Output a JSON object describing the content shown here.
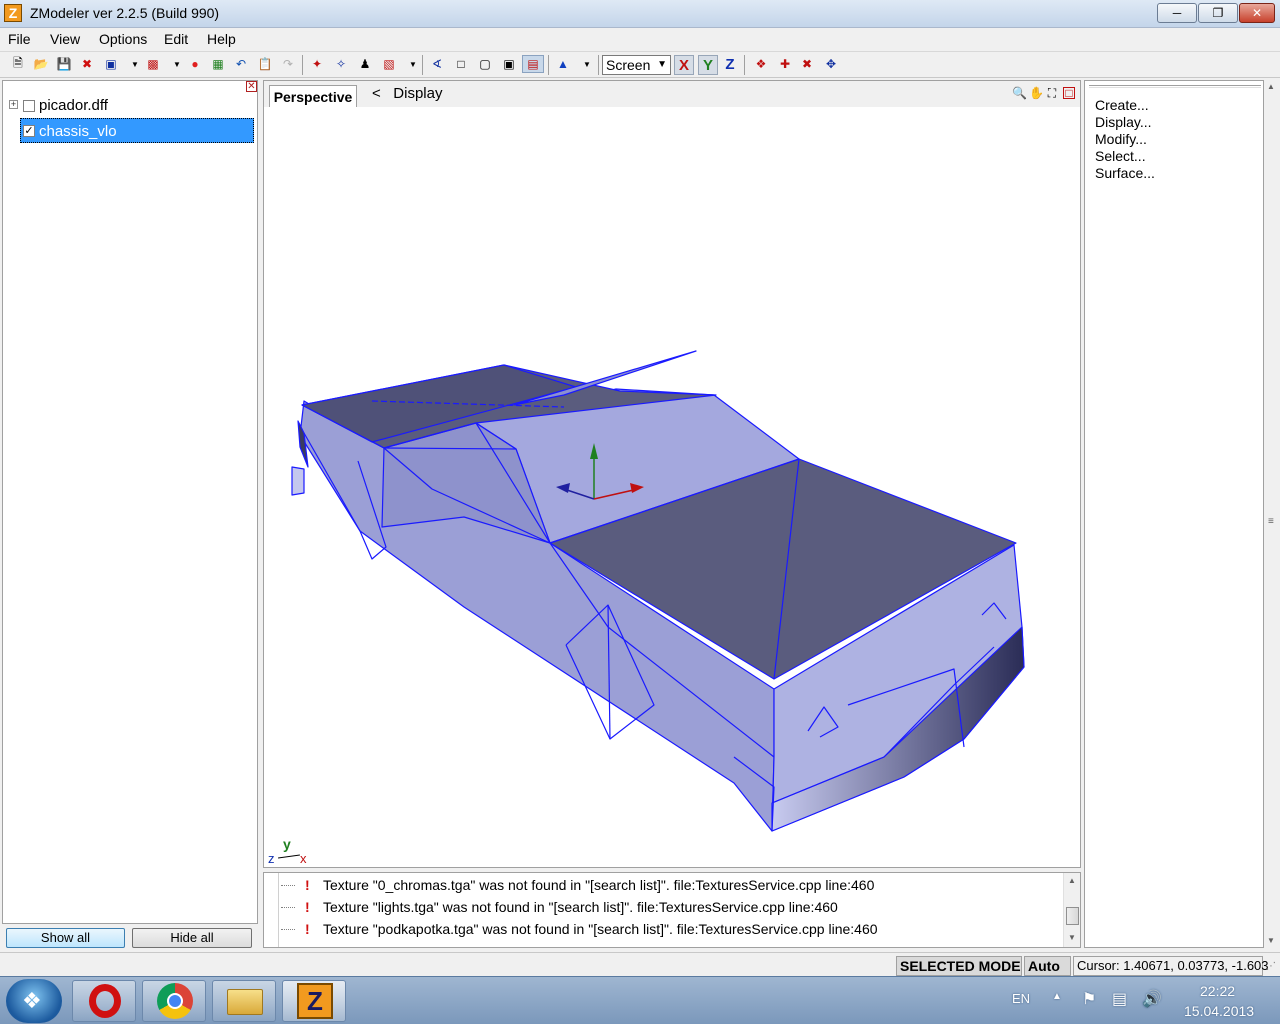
{
  "window": {
    "title": "ZModeler ver 2.2.5 (Build 990)",
    "app_icon": "Z"
  },
  "menu": {
    "items": [
      "File",
      "View",
      "Options",
      "Edit",
      "Help"
    ]
  },
  "toolbar": {
    "view_select": "Screen",
    "axis_x": "X",
    "axis_y": "Y",
    "axis_z": "Z"
  },
  "tree": {
    "items": [
      {
        "label": "picador.dff",
        "checked": false
      },
      {
        "label": "chassis_vlo",
        "checked": true
      }
    ],
    "show_all": "Show all",
    "hide_all": "Hide all"
  },
  "viewport": {
    "tab": "Perspective",
    "display_arrow": "<",
    "display": "Display",
    "axis_y": "y",
    "axis_z": "z",
    "axis_x": "x"
  },
  "log": {
    "rows": [
      "Texture \"0_chromas.tga\" was not found in \"[search list]\". file:TexturesService.cpp line:460",
      "Texture \"lights.tga\" was not found in \"[search list]\". file:TexturesService.cpp line:460",
      "Texture \"podkapotka.tga\" was not found in \"[search list]\". file:TexturesService.cpp line:460"
    ]
  },
  "right_panel": {
    "items": [
      "Create...",
      "Display...",
      "Modify...",
      "Select...",
      "Surface..."
    ]
  },
  "status": {
    "mode": "SELECTED MODE",
    "auto": "Auto",
    "cursor": "Cursor: 1.40671, 0.03773, -1.603"
  },
  "taskbar": {
    "lang": "EN",
    "time": "22:22",
    "date": "15.04.2013",
    "zmodeler_icon": "Z"
  },
  "colors": {
    "selection": "#3399ff",
    "mesh_fill": "#9b9fd6",
    "mesh_dark": "#5a5c7e",
    "mesh_edge": "#1a1aff",
    "error": "#d01010"
  }
}
